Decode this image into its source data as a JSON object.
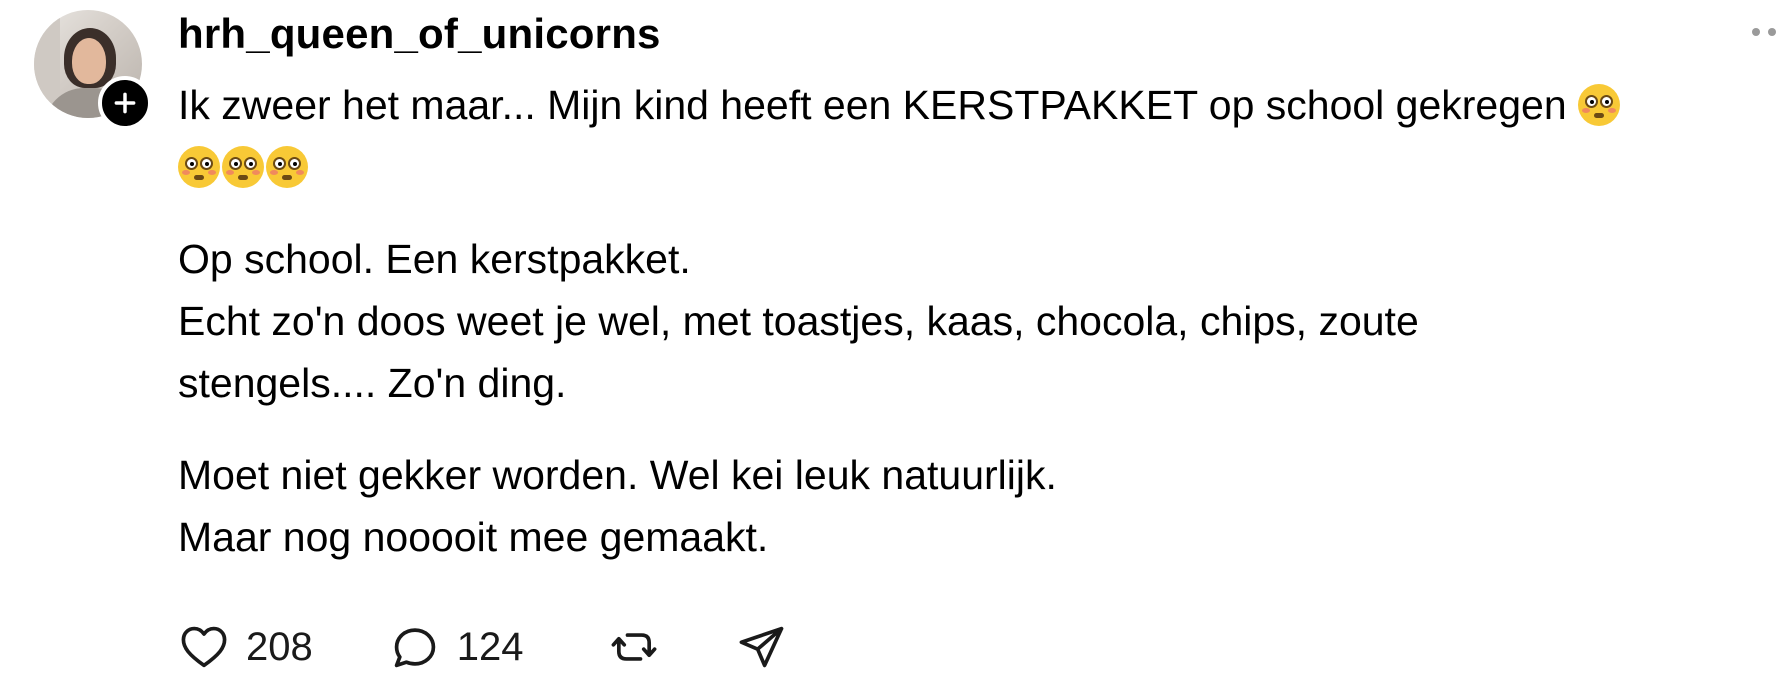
{
  "post": {
    "username": "hrh_queen_of_unicorns",
    "lines": {
      "l1": "Ik zweer het maar... Mijn kind heeft een KERSTPAKKET op school gekregen ",
      "l3": "Op school. Een kerstpakket.",
      "l4": "Echt zo'n doos weet je wel, met toastjes, kaas, chocola, chips, zoute",
      "l5": "stengels.... Zo'n ding.",
      "l6": "Moet niet gekker worden. Wel kei leuk natuurlijk.",
      "l7": "Maar nog nooooit mee gemaakt."
    },
    "emoji": "flushed-face"
  },
  "actions": {
    "likes": "208",
    "replies": "124"
  },
  "icons": [
    "plus-icon",
    "more-icon",
    "heart-icon",
    "comment-icon",
    "repost-icon",
    "share-icon"
  ]
}
